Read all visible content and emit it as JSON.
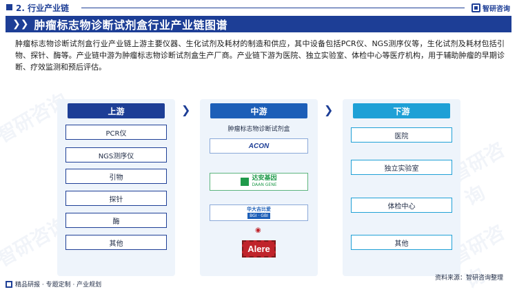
{
  "header": {
    "section_title": "2. 行业产业链",
    "brand": "智研咨询"
  },
  "banner": {
    "title": "肿瘤标志物诊断试剂盒行业产业链图谱"
  },
  "description": "肿瘤标志物诊断试剂盒行业产业链上游主要仪器、生化试剂及耗材的制造和供应，其中设备包括PCR仪、NGS测序仪等，生化试剂及耗材包括引物、探针、酶等。产业链中游为肿瘤标志物诊断试剂盒生产厂商。产业链下游为医院、独立实验室、体检中心等医疗机构，用于辅助肿瘤的早期诊断、疗效监测和预后评估。",
  "upstream": {
    "header": "上游",
    "items": [
      "PCR仪",
      "NGS测序仪",
      "引物",
      "探针",
      "酶",
      "其他"
    ]
  },
  "midstream": {
    "header": "中游",
    "subtitle": "肿瘤标志物诊断试剂盒",
    "logos": {
      "acon": "ACON",
      "daan_cn": "达安基因",
      "daan_en": "DAAN GENE",
      "huada_cn": "华大吉比爱",
      "huada_en": "BGI · GBI",
      "alere": "Alere"
    }
  },
  "downstream": {
    "header": "下游",
    "items": [
      "医院",
      "独立实验室",
      "体检中心",
      "其他"
    ]
  },
  "footer": {
    "left": "精品研报 · 专题定制 · 产业规划",
    "source": "资料来源：智研咨询整理"
  },
  "watermark": "智研咨询",
  "colors": {
    "primary": "#1d3e96",
    "mid": "#1d5fb8",
    "down": "#1ea0d6",
    "acon_red": "#d42a2a",
    "daan_green": "#1f9a4a",
    "alere_red": "#c0242b"
  }
}
